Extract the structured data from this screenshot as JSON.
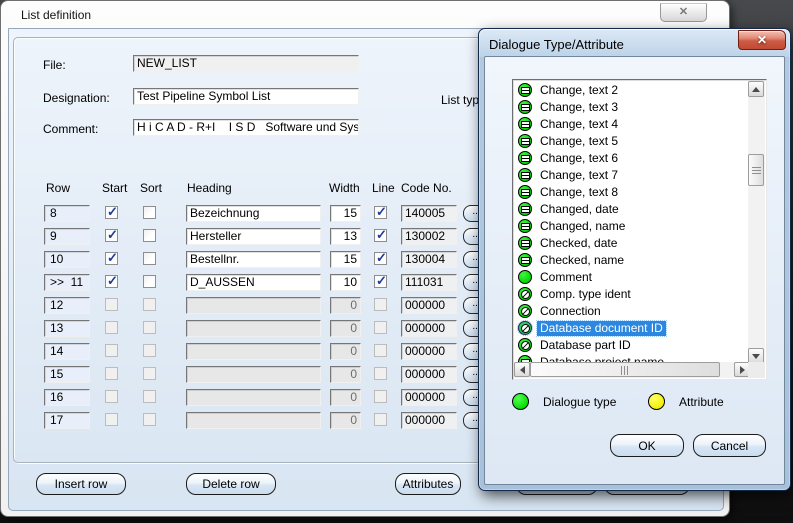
{
  "main_window": {
    "title": "List definition",
    "close_glyph": "✕",
    "fields": {
      "file": {
        "label": "File:",
        "value": "NEW_LIST"
      },
      "designation": {
        "label": "Designation:",
        "value": "Test Pipeline Symbol List"
      },
      "comment": {
        "label": "Comment:",
        "value": "H i C A D - R+I    I S D   Software und System"
      },
      "list_type_label": "List type:"
    },
    "table": {
      "headers": [
        "Row",
        "Start",
        "Sort",
        "Heading",
        "Width",
        "Line",
        "Code No."
      ],
      "dots_label": "...",
      "rows": [
        {
          "row": "8",
          "start": true,
          "sort": false,
          "heading": "Bezeichnung",
          "width": "15",
          "line": true,
          "code": "140005",
          "active": true
        },
        {
          "row": "9",
          "start": true,
          "sort": false,
          "heading": "Hersteller",
          "width": "13",
          "line": true,
          "code": "130002",
          "active": true
        },
        {
          "row": "10",
          "start": true,
          "sort": false,
          "heading": "Bestellnr.",
          "width": "15",
          "line": true,
          "code": "130004",
          "active": true
        },
        {
          "row": ">>  11",
          "start": true,
          "sort": false,
          "heading": "D_AUSSEN",
          "width": "10",
          "line": true,
          "code": "111031",
          "active": true
        },
        {
          "row": "12",
          "start": false,
          "sort": false,
          "heading": "",
          "width": "0",
          "line": false,
          "code": "000000",
          "active": false
        },
        {
          "row": "13",
          "start": false,
          "sort": false,
          "heading": "",
          "width": "0",
          "line": false,
          "code": "000000",
          "active": false
        },
        {
          "row": "14",
          "start": false,
          "sort": false,
          "heading": "",
          "width": "0",
          "line": false,
          "code": "000000",
          "active": false
        },
        {
          "row": "15",
          "start": false,
          "sort": false,
          "heading": "",
          "width": "0",
          "line": false,
          "code": "000000",
          "active": false
        },
        {
          "row": "16",
          "start": false,
          "sort": false,
          "heading": "",
          "width": "0",
          "line": false,
          "code": "000000",
          "active": false
        },
        {
          "row": "17",
          "start": false,
          "sort": false,
          "heading": "",
          "width": "0",
          "line": false,
          "code": "000000",
          "active": false
        }
      ]
    },
    "buttons": [
      {
        "label": "Insert row"
      },
      {
        "label": "Delete row"
      },
      {
        "label": "Attributes"
      }
    ]
  },
  "dialog": {
    "title": "Dialogue Type/Attribute",
    "close_glyph": "✕",
    "items": [
      {
        "label": "Change, text 2",
        "icon": "dialog-text",
        "selected": false
      },
      {
        "label": "Change, text 3",
        "icon": "dialog-text",
        "selected": false
      },
      {
        "label": "Change, text 4",
        "icon": "dialog-text",
        "selected": false
      },
      {
        "label": "Change, text 5",
        "icon": "dialog-text",
        "selected": false
      },
      {
        "label": "Change, text 6",
        "icon": "dialog-text",
        "selected": false
      },
      {
        "label": "Change, text 7",
        "icon": "dialog-text",
        "selected": false
      },
      {
        "label": "Change, text 8",
        "icon": "dialog-text",
        "selected": false
      },
      {
        "label": "Changed, date",
        "icon": "dialog-text",
        "selected": false
      },
      {
        "label": "Changed, name",
        "icon": "dialog-text",
        "selected": false
      },
      {
        "label": "Checked, date",
        "icon": "dialog-text",
        "selected": false
      },
      {
        "label": "Checked, name",
        "icon": "dialog-text",
        "selected": false
      },
      {
        "label": "Comment",
        "icon": "dialog-plain",
        "selected": false
      },
      {
        "label": "Comp. type ident",
        "icon": "dialog-slashed",
        "selected": false
      },
      {
        "label": "Connection",
        "icon": "dialog-slashed",
        "selected": false
      },
      {
        "label": "Database document ID",
        "icon": "dialog-slashed",
        "selected": true
      },
      {
        "label": "Database part ID",
        "icon": "dialog-slashed",
        "selected": false
      },
      {
        "label": "Database project name",
        "icon": "dialog-text",
        "selected": false
      }
    ],
    "legend": [
      {
        "label": "Dialogue type",
        "color": "#00dd00"
      },
      {
        "label": "Attribute",
        "color": "#f0ef00"
      }
    ],
    "buttons": [
      {
        "label": "OK"
      },
      {
        "label": "Cancel"
      }
    ],
    "colors": {
      "dialogue_type": "#00dd00",
      "attribute": "#f0ef00",
      "selection": "#2c87e0"
    }
  }
}
